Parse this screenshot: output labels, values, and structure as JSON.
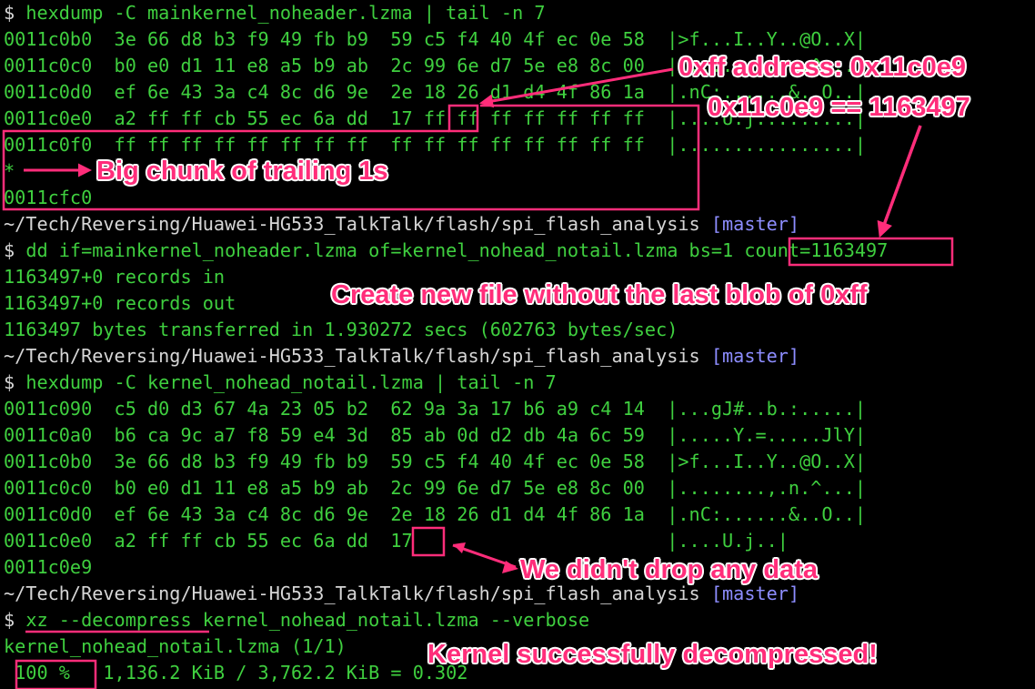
{
  "colors": {
    "background": "#000000",
    "prompt_text": "#3fcf3f",
    "output_text": "#3fcf3f",
    "path_text": "#d6d6d6",
    "branch": "#8d8dff",
    "annotation": "#ff2d7a",
    "annotation_outline": "#ffffff"
  },
  "terminal_lines": [
    {
      "segments": [
        {
          "text": "$ ",
          "c": "w"
        },
        {
          "text": "hexdump -C mainkernel_noheader.lzma | tail -n 7",
          "c": "g"
        }
      ]
    },
    {
      "segments": [
        {
          "text": "0011c0b0  3e 66 d8 b3 f9 49 fb b9  59 c5 f4 40 4f ec 0e 58  |>f...I..Y..@O..X|",
          "c": "g"
        }
      ]
    },
    {
      "segments": [
        {
          "text": "0011c0c0  b0 e0 d1 11 e8 a5 b9 ab  2c 99 6e d7 5e e8 8c 00  |........,.n.^...|",
          "c": "g"
        }
      ]
    },
    {
      "segments": [
        {
          "text": "0011c0d0  ef 6e 43 3a c4 8c d6 9e  2e 18 26 d1 d4 4f 86 1a  |.nC:......&..O..|",
          "c": "g"
        }
      ]
    },
    {
      "segments": [
        {
          "text": "0011c0e0  a2 ff ff cb 55 ec 6a dd  17 ff ff ff ff ff ff ff  |....U.j.........|",
          "c": "g"
        }
      ]
    },
    {
      "segments": [
        {
          "text": "0011c0f0  ff ff ff ff ff ff ff ff  ff ff ff ff ff ff ff ff  |................|",
          "c": "g"
        }
      ]
    },
    {
      "segments": [
        {
          "text": "*",
          "c": "g"
        }
      ]
    },
    {
      "segments": [
        {
          "text": "0011cfc0",
          "c": "g"
        }
      ]
    },
    {
      "segments": [
        {
          "text": "~/Tech/Reversing/Huawei-HG533_TalkTalk/flash/spi_flash_analysis ",
          "c": "w"
        },
        {
          "text": "[master]",
          "c": "b"
        }
      ]
    },
    {
      "segments": [
        {
          "text": "$ ",
          "c": "w"
        },
        {
          "text": "dd if=mainkernel_noheader.lzma of=kernel_nohead_notail.lzma bs=1 count=1163497",
          "c": "g"
        }
      ]
    },
    {
      "segments": [
        {
          "text": "1163497+0 records in",
          "c": "g"
        }
      ]
    },
    {
      "segments": [
        {
          "text": "1163497+0 records out",
          "c": "g"
        }
      ]
    },
    {
      "segments": [
        {
          "text": "1163497 bytes transferred in 1.930272 secs (602763 bytes/sec)",
          "c": "g"
        }
      ]
    },
    {
      "segments": [
        {
          "text": "~/Tech/Reversing/Huawei-HG533_TalkTalk/flash/spi_flash_analysis ",
          "c": "w"
        },
        {
          "text": "[master]",
          "c": "b"
        }
      ]
    },
    {
      "segments": [
        {
          "text": "$ ",
          "c": "w"
        },
        {
          "text": "hexdump -C kernel_nohead_notail.lzma | tail -n 7",
          "c": "g"
        }
      ]
    },
    {
      "segments": [
        {
          "text": "0011c090  c5 d0 d3 67 4a 23 05 b2  62 9a 3a 17 b6 a9 c4 14  |...gJ#..b.:.....|",
          "c": "g"
        }
      ]
    },
    {
      "segments": [
        {
          "text": "0011c0a0  b6 ca 9c a7 f8 59 e4 3d  85 ab 0d d2 db 4a 6c 59  |.....Y.=.....JlY|",
          "c": "g"
        }
      ]
    },
    {
      "segments": [
        {
          "text": "0011c0b0  3e 66 d8 b3 f9 49 fb b9  59 c5 f4 40 4f ec 0e 58  |>f...I..Y..@O..X|",
          "c": "g"
        }
      ]
    },
    {
      "segments": [
        {
          "text": "0011c0c0  b0 e0 d1 11 e8 a5 b9 ab  2c 99 6e d7 5e e8 8c 00  |........,.n.^...|",
          "c": "g"
        }
      ]
    },
    {
      "segments": [
        {
          "text": "0011c0d0  ef 6e 43 3a c4 8c d6 9e  2e 18 26 d1 d4 4f 86 1a  |.nC:......&..O..|",
          "c": "g"
        }
      ]
    },
    {
      "segments": [
        {
          "text": "0011c0e0  a2 ff ff cb 55 ec 6a dd  17                       |....U.j..|",
          "c": "g"
        }
      ]
    },
    {
      "segments": [
        {
          "text": "0011c0e9",
          "c": "g"
        }
      ]
    },
    {
      "segments": [
        {
          "text": "~/Tech/Reversing/Huawei-HG533_TalkTalk/flash/spi_flash_analysis ",
          "c": "w"
        },
        {
          "text": "[master]",
          "c": "b"
        }
      ]
    },
    {
      "segments": [
        {
          "text": "$ ",
          "c": "w"
        },
        {
          "text": "xz --decompress kernel_nohead_notail.lzma --verbose",
          "c": "g"
        }
      ]
    },
    {
      "segments": [
        {
          "text": "kernel_nohead_notail.lzma (1/1)",
          "c": "g"
        }
      ]
    },
    {
      "segments": [
        {
          "text": " 100 %   1,136.2 KiB / 3,762.2 KiB = 0.302",
          "c": "g"
        }
      ]
    }
  ],
  "annotations": {
    "ff_address": "0xff address: 0x11c0e9",
    "ff_decimal": "0x11c0e9 == 1163497",
    "trailing_ones": "Big chunk of trailing 1s",
    "create_file": "Create new file without the last blob of 0xff",
    "no_data_dropped": "We didn't drop any data",
    "decompressed": "Kernel successfully decompressed!"
  }
}
